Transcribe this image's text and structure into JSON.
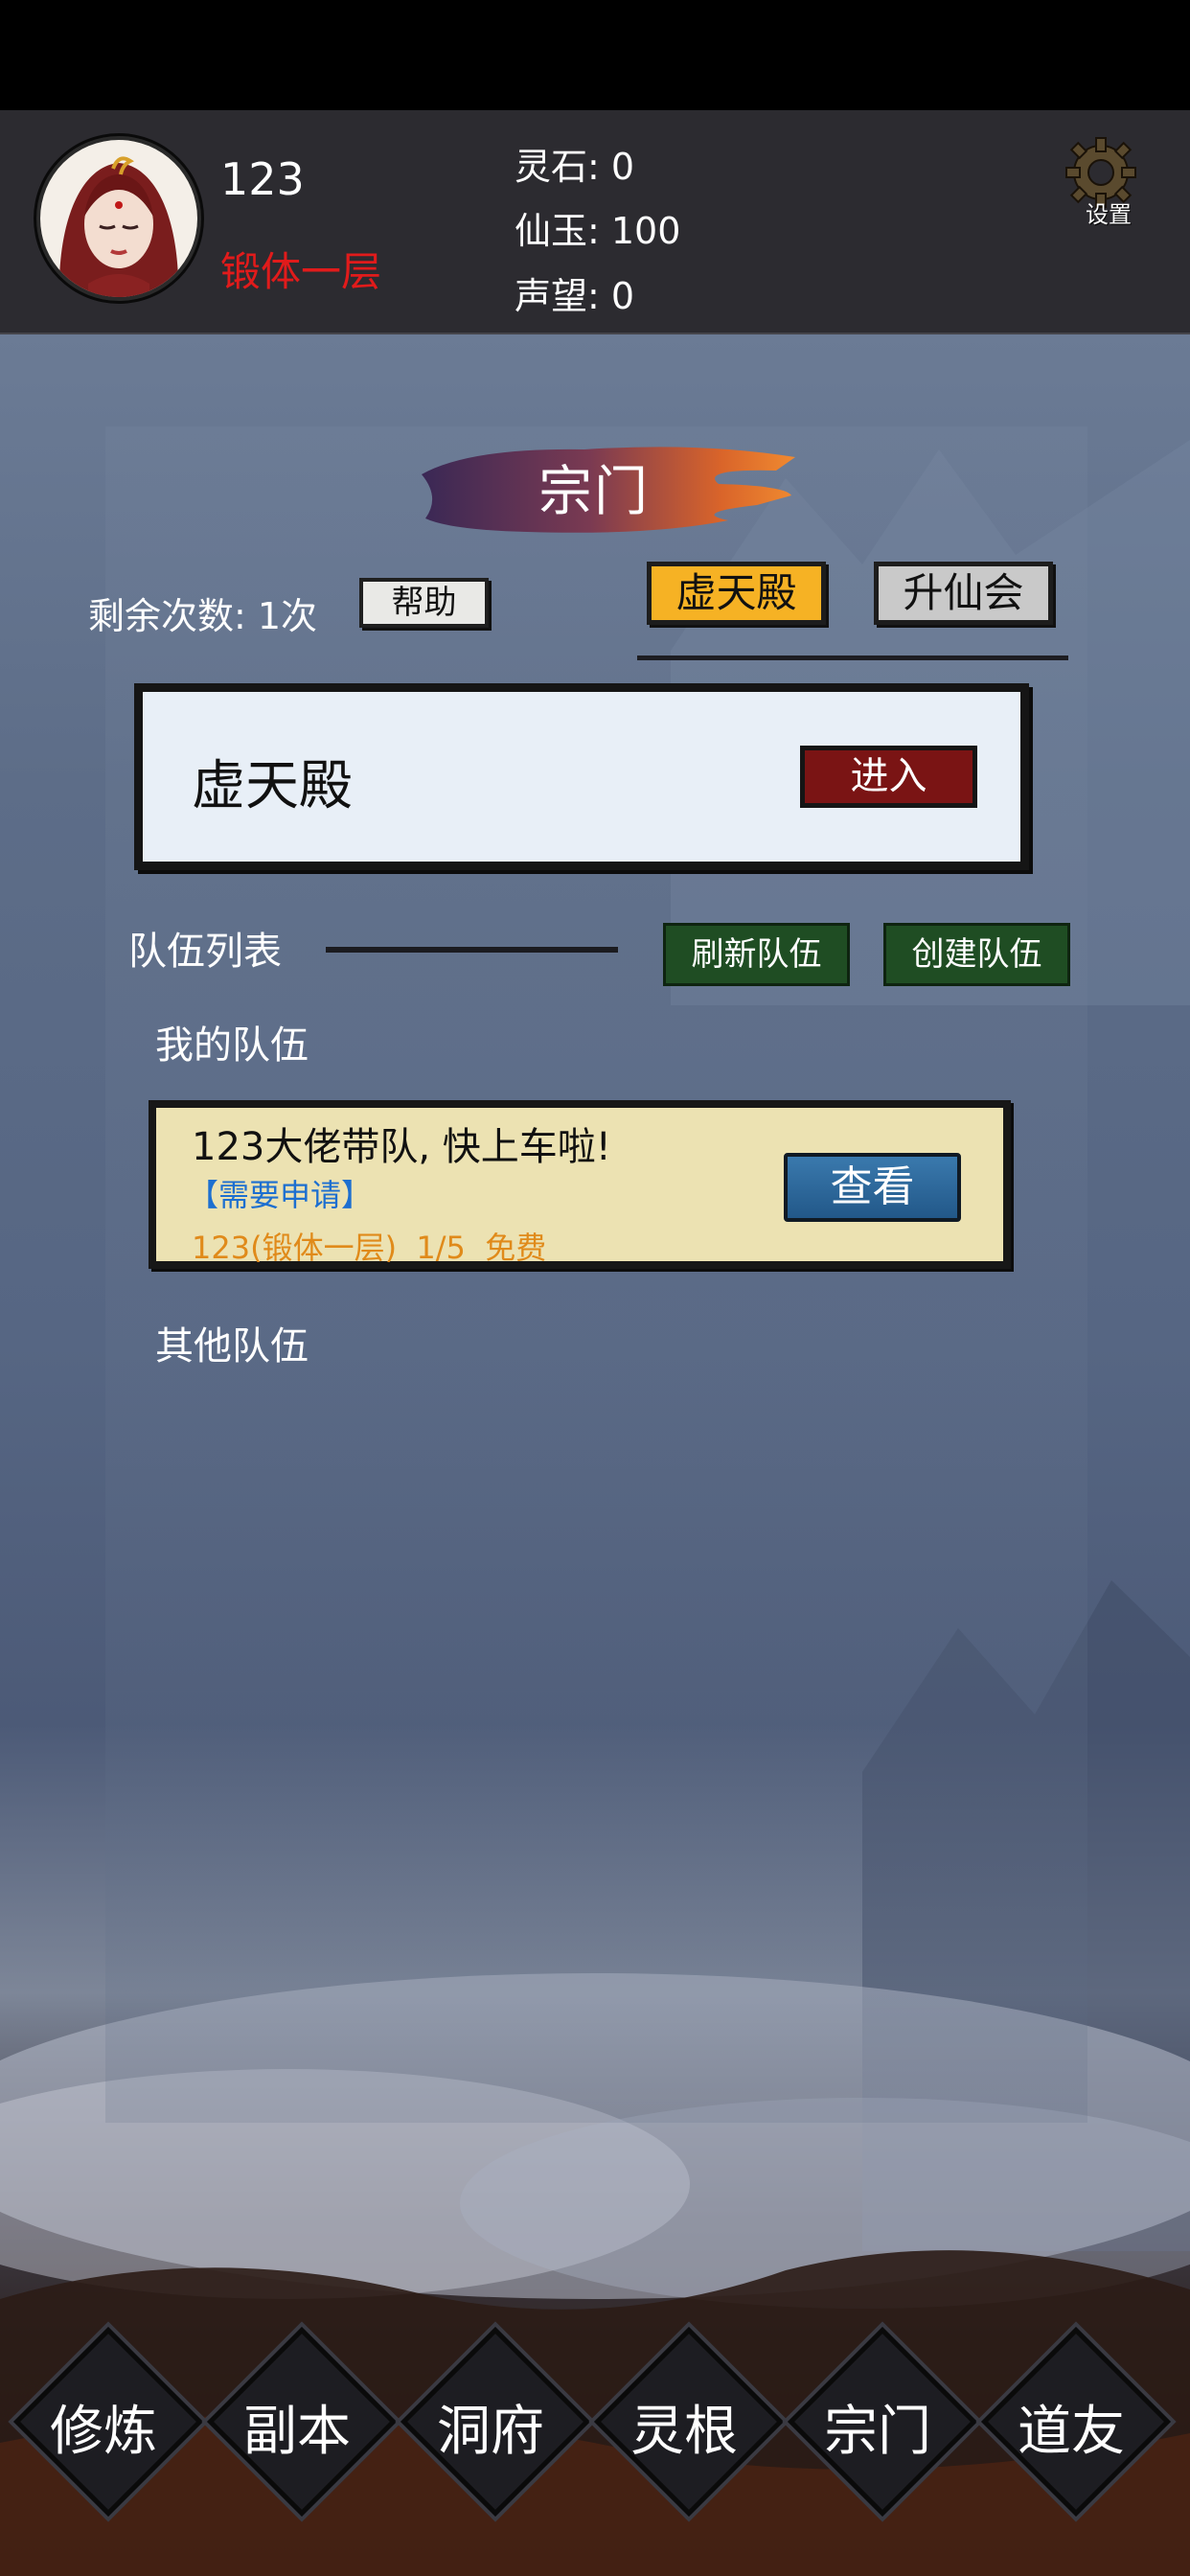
{
  "header": {
    "player_name": "123",
    "player_realm": "锻体一层",
    "resources": [
      {
        "label": "灵石: 0"
      },
      {
        "label": "仙玉: 100"
      },
      {
        "label": "声望: 0"
      }
    ],
    "settings_label": "设置"
  },
  "sect_page": {
    "title": "宗门",
    "remaining": "剩余次数: 1次",
    "help_label": "帮助",
    "tabs": [
      {
        "label": "虚天殿",
        "active": true
      },
      {
        "label": "升仙会",
        "active": false
      }
    ],
    "dungeon_card": {
      "name": "虚天殿",
      "enter_label": "进入"
    },
    "team_list_label": "队伍列表",
    "refresh_label": "刷新队伍",
    "create_label": "创建队伍",
    "my_team_label": "我的队伍",
    "team_card": {
      "title": "123大佬带队, 快上车啦!",
      "apply_tag": "【需要申请】",
      "info": "123(锻体一层)  1/5  免费",
      "view_label": "查看"
    },
    "other_teams_label": "其他队伍"
  },
  "nav": [
    {
      "label": "修炼"
    },
    {
      "label": "副本"
    },
    {
      "label": "洞府"
    },
    {
      "label": "灵根"
    },
    {
      "label": "宗门"
    },
    {
      "label": "道友"
    }
  ],
  "colors": {
    "realm_red": "#e11b1b",
    "active_tab": "#f6b224",
    "enter_button": "#7a1414",
    "green_button": "#1f4d23",
    "apply_blue": "#1d6fd0",
    "team_info_orange": "#e08a1a"
  }
}
